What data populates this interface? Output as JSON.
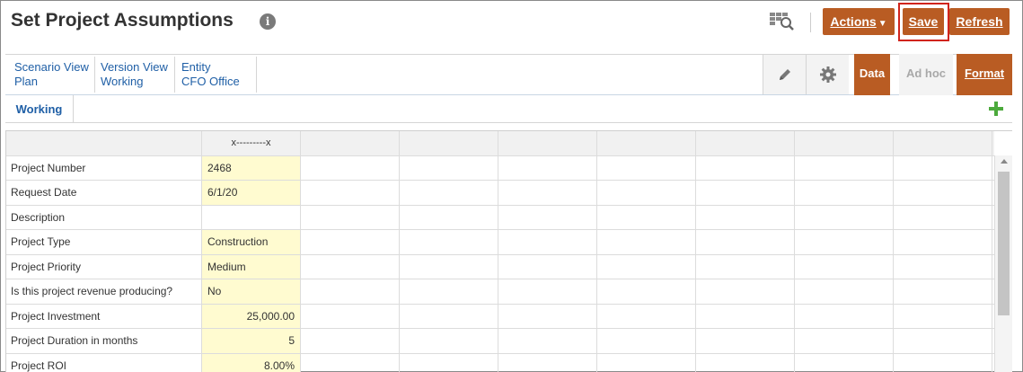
{
  "header": {
    "title": "Set Project Assumptions",
    "info_icon": "info-icon",
    "buttons": {
      "actions": "Actions",
      "save": "Save",
      "refresh": "Refresh"
    }
  },
  "pov": [
    {
      "dimension": "Scenario View",
      "member": "Plan"
    },
    {
      "dimension": "Version View",
      "member": "Working"
    },
    {
      "dimension": "Entity",
      "member": "CFO Office"
    }
  ],
  "toolbar": {
    "data": "Data",
    "adhoc": "Ad hoc",
    "format": "Format"
  },
  "sheet": {
    "active_tab": "Working"
  },
  "grid": {
    "column_header": "x---------x",
    "rows": [
      {
        "label": "Project Number",
        "value": "2468"
      },
      {
        "label": "Request Date",
        "value": "6/1/20"
      },
      {
        "label": "Description",
        "value": ""
      },
      {
        "label": "Project Type",
        "value": "Construction"
      },
      {
        "label": "Project Priority",
        "value": "Medium"
      },
      {
        "label": "Is this project revenue producing?",
        "value": "No"
      },
      {
        "label": "Project Investment",
        "value": "25,000.00"
      },
      {
        "label": "Project Duration in months",
        "value": "5"
      },
      {
        "label": "Project ROI",
        "value": "8.00%"
      }
    ]
  },
  "colors": {
    "accent": "#b95c23",
    "link": "#1f5fa6",
    "input_cell": "#fffbd0",
    "highlight": "#d1241c"
  }
}
